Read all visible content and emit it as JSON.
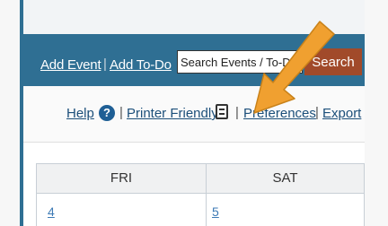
{
  "nav": {
    "add_event": "Add Event",
    "separator": "|",
    "add_todo": "Add To-Do",
    "search_placeholder": "Search Events / To-Do's",
    "search_button": "Search"
  },
  "toolbar": {
    "help": "Help",
    "help_icon": "question-circle-icon",
    "printer_friendly": "Printer Friendly",
    "printer_icon": "printer-icon",
    "preferences": "Preferences",
    "export": "Export",
    "separator": "|"
  },
  "calendar": {
    "columns": [
      "FRI",
      "SAT"
    ],
    "days": [
      "4",
      "5"
    ]
  },
  "annotation": {
    "type": "arrow",
    "color": "#f0a030",
    "points_to": "preferences"
  },
  "colors": {
    "nav_background": "#2f6f93",
    "search_button": "#a14a2a",
    "link": "#1c4f7a",
    "annotation_arrow": "#f0a030"
  }
}
